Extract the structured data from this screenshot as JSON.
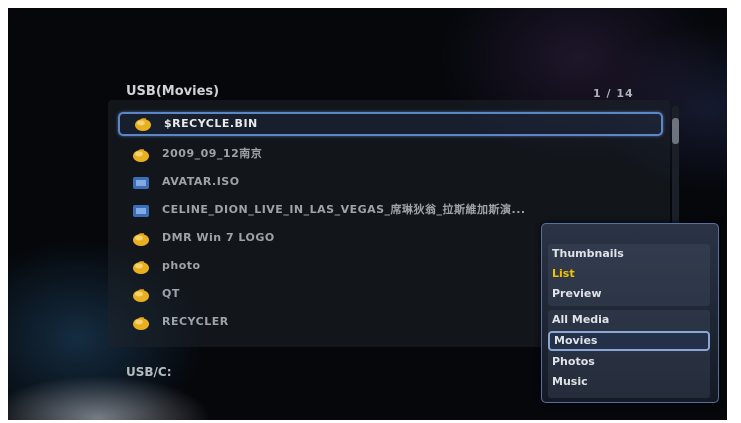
{
  "header": {
    "title": "USB(Movies)",
    "page_counter": "1 / 14"
  },
  "files": [
    {
      "name": "$RECYCLE.BIN",
      "icon": "folder-icon",
      "selected": true
    },
    {
      "name": "2009_09_12南京",
      "icon": "folder-icon",
      "selected": false
    },
    {
      "name": "AVATAR.ISO",
      "icon": "iso-file-icon",
      "selected": false
    },
    {
      "name": "CELINE_DION_LIVE_IN_LAS_VEGAS_席琳狄翁_拉斯維加斯演...",
      "icon": "iso-file-icon",
      "selected": false
    },
    {
      "name": "DMR Win 7 LOGO",
      "icon": "folder-icon",
      "selected": false
    },
    {
      "name": "photo",
      "icon": "folder-icon",
      "selected": false
    },
    {
      "name": "QT",
      "icon": "folder-icon",
      "selected": false
    },
    {
      "name": "RECYCLER",
      "icon": "folder-icon",
      "selected": false
    }
  ],
  "footer": {
    "path": "USB/C:"
  },
  "view_menu": {
    "view_modes": [
      "Thumbnails",
      "List",
      "Preview"
    ],
    "active_view_mode": "List",
    "media_filters": [
      "All Media",
      "Movies",
      "Photos",
      "Music"
    ],
    "focused_filter": "Movies"
  },
  "colors": {
    "folder_icon": "#e8b020",
    "iso_icon": "#3a6fb8",
    "selection_border": "#5b86c7",
    "active_view_text": "#f2c200"
  }
}
